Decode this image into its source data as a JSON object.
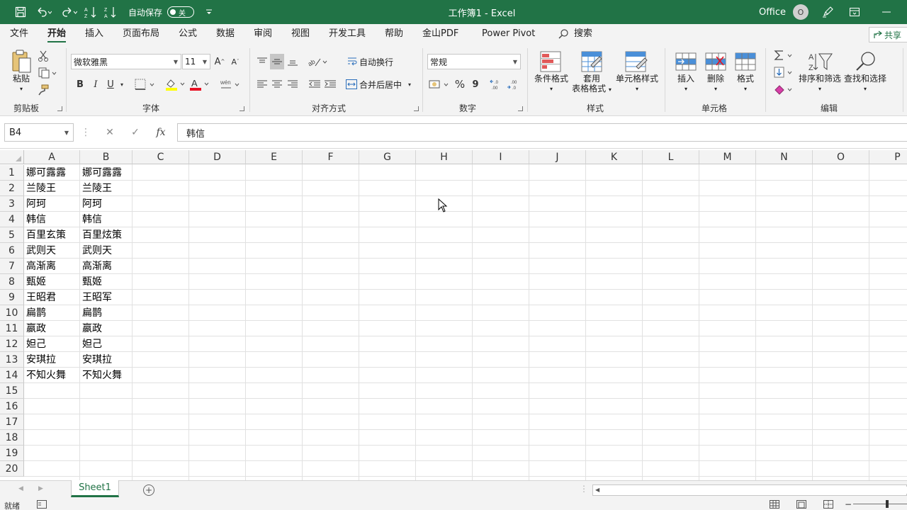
{
  "window": {
    "title": "工作簿1  -  Excel",
    "autosave_label": "自动保存",
    "autosave_state": "关",
    "account": "Office",
    "account_initial": "O"
  },
  "menu": {
    "tabs": [
      "文件",
      "开始",
      "插入",
      "页面布局",
      "公式",
      "数据",
      "审阅",
      "视图",
      "开发工具",
      "帮助",
      "金山PDF",
      "Power Pivot"
    ],
    "active_tab": "开始",
    "search_label": "搜索",
    "share_label": "共享"
  },
  "ribbon": {
    "clipboard": {
      "group": "剪贴板",
      "paste": "粘贴"
    },
    "font": {
      "group": "字体",
      "font_name": "微软雅黑",
      "font_size": "11",
      "bold": "B",
      "italic": "I",
      "underline": "U"
    },
    "alignment": {
      "group": "对齐方式",
      "wrap": "自动换行",
      "merge": "合并后居中"
    },
    "number": {
      "group": "数字",
      "format": "常规",
      "percent": "%",
      "comma": "9"
    },
    "styles": {
      "group": "样式",
      "conditional": "条件格式",
      "table_line1": "套用",
      "table_line2": "表格格式",
      "cell_styles": "单元格样式"
    },
    "cells": {
      "group": "单元格",
      "insert": "插入",
      "delete": "删除",
      "format": "格式"
    },
    "editing": {
      "group": "编辑",
      "sort_filter": "排序和筛选",
      "find_select": "查找和选择"
    }
  },
  "formula_bar": {
    "name_box": "B4",
    "content": "韩信"
  },
  "grid": {
    "columns": [
      "A",
      "B",
      "C",
      "D",
      "E",
      "F",
      "G",
      "H",
      "I",
      "J",
      "K",
      "L",
      "M",
      "N",
      "O",
      "P"
    ],
    "row_numbers": [
      "1",
      "2",
      "3",
      "4",
      "5",
      "6",
      "7",
      "8",
      "9",
      "10",
      "11",
      "12",
      "13",
      "14",
      "15",
      "16",
      "17",
      "18",
      "19",
      "20"
    ],
    "col_a": [
      "娜可露露",
      "兰陵王",
      "阿珂",
      "韩信",
      "百里玄策",
      "武则天",
      "高渐离",
      "甄姬",
      "王昭君",
      "扁鹊",
      "嬴政",
      "妲己",
      "安琪拉",
      "不知火舞"
    ],
    "col_b": [
      "娜可露露",
      "兰陵王",
      "阿珂",
      "韩信",
      "百里炫策",
      "武则天",
      "高渐离",
      "甄姬",
      "王昭军",
      "扁鹊",
      "嬴政",
      "妲己",
      "安琪拉",
      "不知火舞"
    ]
  },
  "sheets": {
    "tabs": [
      "Sheet1"
    ],
    "active": "Sheet1"
  },
  "status": {
    "text": "就绪"
  }
}
